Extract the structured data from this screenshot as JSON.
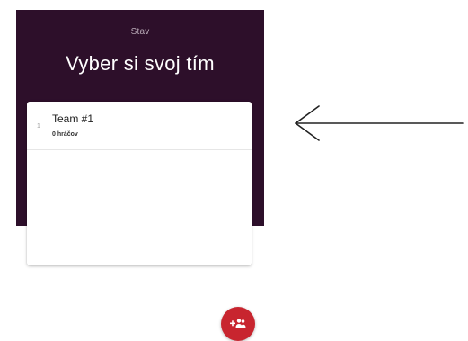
{
  "header": {
    "status_label": "Stav",
    "title": "Vyber si svoj tím"
  },
  "teams": [
    {
      "index": "1",
      "name": "Team #1",
      "players": "0 hráčov"
    }
  ],
  "fab": {
    "icon": "add-group-icon"
  },
  "annotation": {
    "icon": "left-arrow-icon"
  },
  "colors": {
    "header_bg": "#2d0f2a",
    "fab_bg": "#c8252f"
  }
}
